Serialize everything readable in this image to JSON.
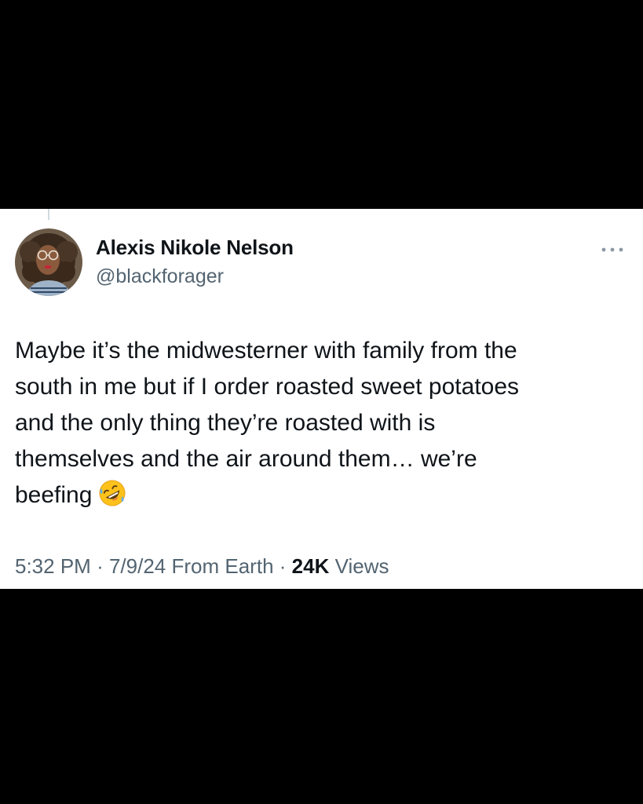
{
  "tweet": {
    "author": {
      "display_name": "Alexis Nikole Nelson",
      "handle": "@blackforager"
    },
    "text_lines": [
      "Maybe it’s the midwesterner with family from the",
      "south in me but if I order roasted sweet potatoes",
      "and the only thing they’re roasted with is",
      "themselves and the air around them… we’re",
      "beefing"
    ],
    "emoji": "rolling-on-the-floor-laughing-emoji",
    "meta": {
      "time": "5:32 PM",
      "separator": "·",
      "date": "7/9/24",
      "source": "From Earth",
      "views_count": "24K",
      "views_label": "Views"
    },
    "more_icon": "more-horizontal-icon"
  },
  "colors": {
    "background": "#000000",
    "card": "#ffffff",
    "primary_text": "#0f1419",
    "secondary_text": "#536471",
    "icon_gray": "#8b98a5"
  }
}
